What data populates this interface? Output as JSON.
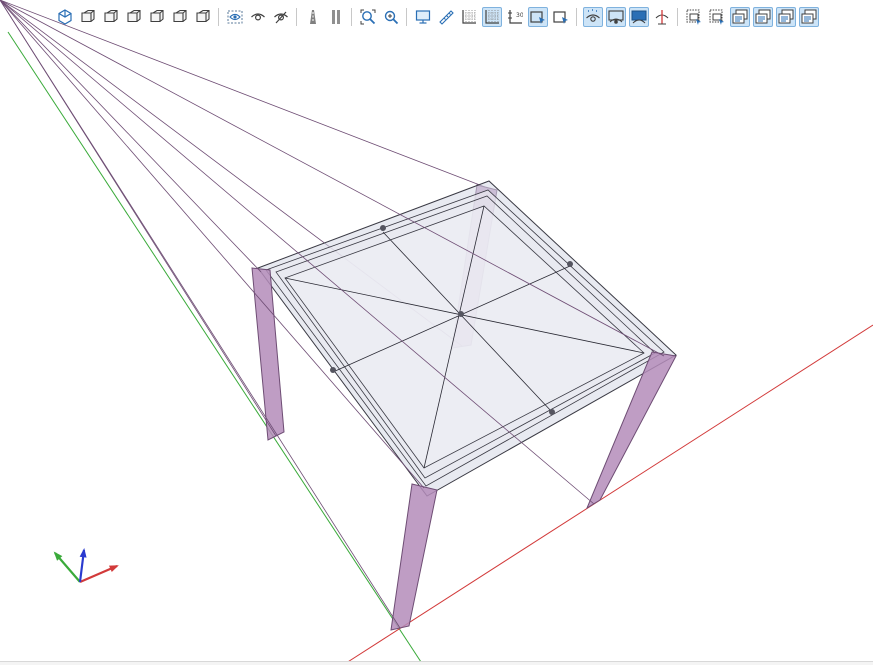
{
  "toolbar": {
    "groups": [
      [
        {
          "icon": "isometric-view-icon",
          "kind": "cube-iso"
        },
        {
          "icon": "front-view-icon",
          "kind": "cube"
        },
        {
          "icon": "back-view-icon",
          "kind": "cube"
        },
        {
          "icon": "left-view-icon",
          "kind": "cube"
        },
        {
          "icon": "right-view-icon",
          "kind": "cube"
        },
        {
          "icon": "top-view-icon",
          "kind": "cube"
        },
        {
          "icon": "bottom-view-icon",
          "kind": "cube"
        }
      ],
      [
        {
          "icon": "hide-selected-icon",
          "kind": "eye-box"
        },
        {
          "icon": "show-all-icon",
          "kind": "eye"
        },
        {
          "icon": "hide-unselected-icon",
          "kind": "eye-slash"
        }
      ],
      [
        {
          "icon": "perspective-icon",
          "kind": "road"
        },
        {
          "icon": "parallel-projection-icon",
          "kind": "parallel"
        }
      ],
      [
        {
          "icon": "zoom-extents-icon",
          "kind": "zoom-ext"
        },
        {
          "icon": "zoom-window-icon",
          "kind": "zoom"
        }
      ],
      [
        {
          "icon": "display-settings-icon",
          "kind": "monitor"
        },
        {
          "icon": "measure-icon",
          "kind": "ruler"
        },
        {
          "icon": "grid-icon",
          "kind": "grid"
        },
        {
          "icon": "grid-snap-icon",
          "kind": "grid",
          "active": true
        },
        {
          "icon": "axes-display-icon",
          "kind": "axes"
        },
        {
          "icon": "select-box-icon",
          "kind": "select-box",
          "active": true
        },
        {
          "icon": "select-cross-icon",
          "kind": "select-box"
        }
      ],
      [
        {
          "icon": "show-nodes-icon",
          "kind": "view-dots",
          "active": true
        },
        {
          "icon": "show-edges-icon",
          "kind": "view-frame",
          "active": true
        },
        {
          "icon": "shaded-view-icon",
          "kind": "view-solid",
          "active": true
        },
        {
          "icon": "section-cut-icon",
          "kind": "view-cut"
        }
      ],
      [
        {
          "icon": "layer-filter-icon",
          "kind": "filter"
        },
        {
          "icon": "layer-filter-2-icon",
          "kind": "filter"
        },
        {
          "icon": "layer-display-1-icon",
          "kind": "layers",
          "active": true
        },
        {
          "icon": "layer-display-2-icon",
          "kind": "layers",
          "active": true
        },
        {
          "icon": "layer-display-3-icon",
          "kind": "layers",
          "active": true
        },
        {
          "icon": "layer-display-4-icon",
          "kind": "layers",
          "active": true
        }
      ]
    ]
  },
  "model": {
    "column_color": "#b48cba",
    "column_stroke": "#6e4d74",
    "slab_fill": "#d6d8e6",
    "beam_stroke": "#3a3a44",
    "axis_x_color": "#d23a3a",
    "axis_y_color": "#3aaa3a",
    "axis_z_color": "#2a3acf"
  },
  "triad": {
    "x_label": "",
    "y_label": "",
    "z_label": ""
  }
}
